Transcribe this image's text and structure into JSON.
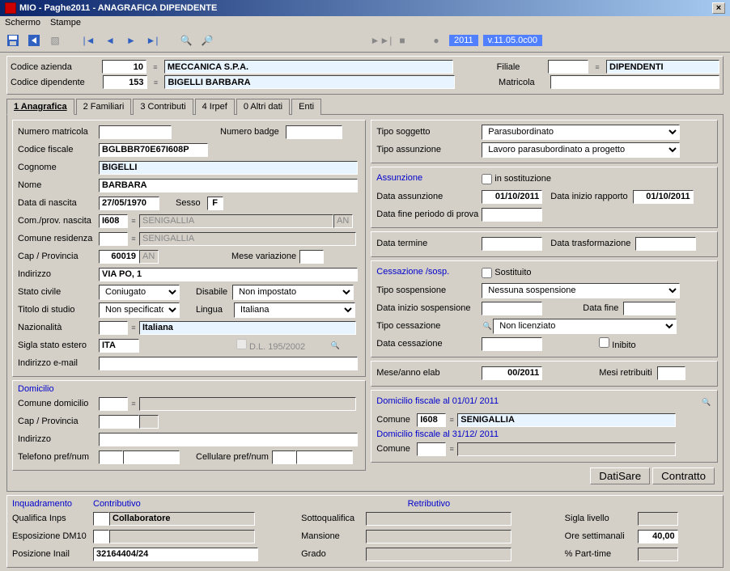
{
  "window": {
    "title": "MIO - Paghe2011 - ANAGRAFICA DIPENDENTE"
  },
  "menu": {
    "schermo": "Schermo",
    "stampe": "Stampe"
  },
  "version": {
    "year": "2011",
    "ver": "v.11.05.0c00"
  },
  "header": {
    "codice_azienda_lbl": "Codice azienda",
    "codice_azienda": "10",
    "azienda_nome": "MECCANICA S.P.A.",
    "codice_dipendente_lbl": "Codice dipendente",
    "codice_dipendente": "153",
    "dipendente_nome": "BIGELLI BARBARA",
    "filiale_lbl": "Filiale",
    "filiale_val": "DIPENDENTI",
    "matricola_lbl": "Matricola"
  },
  "tabs": {
    "t1": "1 Anagrafica",
    "t2": "2 Familiari",
    "t3": "3 Contributi",
    "t4": "4 Irpef",
    "t5": "0 Altri dati",
    "t6": "Enti"
  },
  "left": {
    "numero_matricola_lbl": "Numero matricola",
    "numero_badge_lbl": "Numero badge",
    "codice_fiscale_lbl": "Codice fiscale",
    "codice_fiscale": "BGLBBR70E67I608P",
    "cognome_lbl": "Cognome",
    "cognome": "BIGELLI",
    "nome_lbl": "Nome",
    "nome": "BARBARA",
    "data_nascita_lbl": "Data di nascita",
    "data_nascita": "27/05/1970",
    "sesso_lbl": "Sesso",
    "sesso": "F",
    "com_nascita_lbl": "Com./prov. nascita",
    "com_nascita_cod": "I608",
    "com_nascita": "SENIGALLIA",
    "prov_nascita": "AN",
    "comune_res_lbl": "Comune residenza",
    "comune_res": "SENIGALLIA",
    "cap_lbl": "Cap / Provincia",
    "cap": "60019",
    "prov": "AN",
    "mese_var_lbl": "Mese variazione",
    "indirizzo_lbl": "Indirizzo",
    "indirizzo": "VIA PO, 1",
    "stato_civile_lbl": "Stato civile",
    "stato_civile": "Coniugato",
    "disabile_lbl": "Disabile",
    "disabile": "Non impostato",
    "titolo_studio_lbl": "Titolo di studio",
    "titolo_studio": "Non specificato",
    "lingua_lbl": "Lingua",
    "lingua": "Italiana",
    "nazionalita_lbl": "Nazionalità",
    "nazionalita": "Italiana",
    "sigla_estero_lbl": "Sigla stato estero",
    "sigla_estero": "ITA",
    "dl195_lbl": "D.L. 195/2002",
    "email_lbl": "Indirizzo e-mail",
    "domicilio_hdr": "Domicilio",
    "comune_dom_lbl": "Comune domicilio",
    "cap2_lbl": "Cap / Provincia",
    "indirizzo2_lbl": "Indirizzo",
    "tel_lbl": "Telefono pref/num",
    "cell_lbl": "Cellulare pref/num"
  },
  "right": {
    "tipo_soggetto_lbl": "Tipo soggetto",
    "tipo_soggetto": "Parasubordinato",
    "tipo_assunzione_lbl": "Tipo assunzione",
    "tipo_assunzione": "Lavoro parasubordinato a progetto",
    "assunzione_hdr": "Assunzione",
    "in_sost_lbl": "in sostituzione",
    "data_ass_lbl": "Data assunzione",
    "data_ass": "01/10/2011",
    "data_rapp_lbl": "Data inizio rapporto",
    "data_rapp": "01/10/2011",
    "data_prova_lbl": "Data fine periodo di prova",
    "data_termine_lbl": "Data termine",
    "data_trasf_lbl": "Data trasformazione",
    "cessazione_hdr": "Cessazione /sosp.",
    "sostituito_lbl": "Sostituito",
    "tipo_sosp_lbl": "Tipo sospensione",
    "tipo_sosp": "Nessuna sospensione",
    "data_inizio_sosp_lbl": "Data inizio sospensione",
    "data_fine_lbl": "Data fine",
    "tipo_cess_lbl": "Tipo cessazione",
    "tipo_cess": "Non licenziato",
    "data_cess_lbl": "Data cessazione",
    "inibito_lbl": "Inibito",
    "mese_elab_lbl": "Mese/anno elab",
    "mese_elab": "00/2011",
    "mesi_retr_lbl": "Mesi retribuiti",
    "dom_fisc1_hdr": "Domicilio fiscale al 01/01/  2011",
    "comune1_lbl": "Comune",
    "comune1_cod": "I608",
    "comune1": "SENIGALLIA",
    "dom_fisc2_hdr": "Domicilio fiscale al 31/12/  2011",
    "comune2_lbl": "Comune",
    "btn_datisare": "DatiSare",
    "btn_contratto": "Contratto"
  },
  "bottom": {
    "inquadramento_hdr": "Inquadramento",
    "contributivo_hdr": "Contributivo",
    "retributivo_hdr": "Retributivo",
    "qualifica_lbl": "Qualifica Inps",
    "qualifica": "Collaboratore",
    "esposizione_lbl": "Esposizione DM10",
    "posizione_lbl": "Posizione Inail",
    "posizione": "32164404/24",
    "sottoqual_lbl": "Sottoqualifica",
    "mansione_lbl": "Mansione",
    "grado_lbl": "Grado",
    "sigla_liv_lbl": "Sigla livello",
    "ore_lbl": "Ore settimanali",
    "ore": "40,00",
    "pt_lbl": "% Part-time"
  }
}
